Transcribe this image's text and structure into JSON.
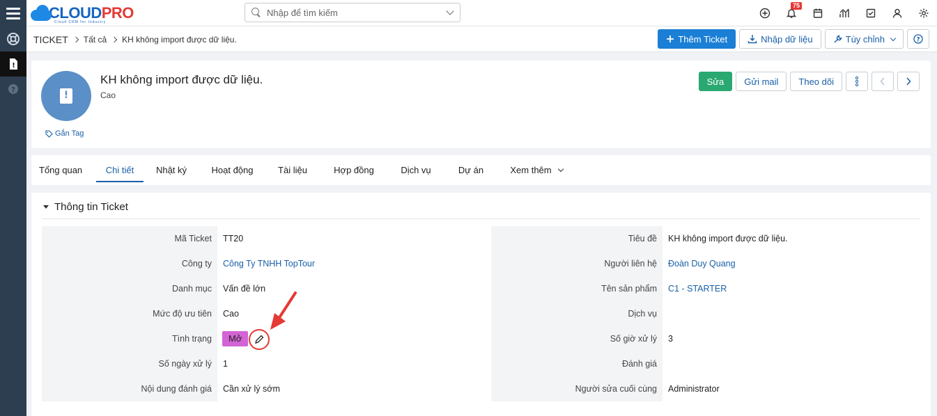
{
  "app": {
    "logo_primary": "CLOUD",
    "logo_secondary": "PRO",
    "logo_tagline": "Cloud CRM for Industry"
  },
  "search": {
    "placeholder": "Nhập để tìm kiếm"
  },
  "notifications": {
    "count": "75"
  },
  "breadcrumb": {
    "module": "TICKET",
    "level1": "Tất cả",
    "current": "KH không import được dữ liệu."
  },
  "toolbar": {
    "add_label": "Thêm Ticket",
    "import_label": "Nhập dữ liệu",
    "customize_label": "Tùy chỉnh"
  },
  "record": {
    "title": "KH không import được dữ liệu.",
    "subtitle": "Cao",
    "tag_label": "Gắn Tag",
    "edit_label": "Sửa",
    "mail_label": "Gửi mail",
    "follow_label": "Theo dõi"
  },
  "tabs": [
    {
      "label": "Tổng quan"
    },
    {
      "label": "Chi tiết"
    },
    {
      "label": "Nhật ký"
    },
    {
      "label": "Hoạt động"
    },
    {
      "label": "Tài liệu"
    },
    {
      "label": "Hợp đồng"
    },
    {
      "label": "Dịch vụ"
    },
    {
      "label": "Dự án"
    },
    {
      "label": "Xem thêm"
    }
  ],
  "section": {
    "title": "Thông tin Ticket",
    "left": [
      {
        "label": "Mã Ticket",
        "value": "TT20"
      },
      {
        "label": "Công ty",
        "value": "Công Ty TNHH TopTour"
      },
      {
        "label": "Danh mục",
        "value": "Vấn đề lớn"
      },
      {
        "label": "Mức độ ưu tiên",
        "value": "Cao"
      },
      {
        "label": "Tình trạng",
        "value": "Mở"
      },
      {
        "label": "Số ngày xử lý",
        "value": "1"
      },
      {
        "label": "Nội dung đánh giá",
        "value": "Cần xử lý sớm"
      }
    ],
    "right": [
      {
        "label": "Tiêu đề",
        "value": "KH không import được dữ liệu."
      },
      {
        "label": "Người liên hệ",
        "value": "Đoàn Duy Quang"
      },
      {
        "label": "Tên sản phẩm",
        "value": "C1 - STARTER"
      },
      {
        "label": "Dịch vụ",
        "value": ""
      },
      {
        "label": "Số giờ xử lý",
        "value": "3"
      },
      {
        "label": "Đánh giá",
        "value": ""
      },
      {
        "label": "Người sửa cuối cùng",
        "value": "Administrator"
      }
    ]
  },
  "colors": {
    "primary": "#1b7fd6",
    "success": "#2aa872",
    "sidebar": "#2c3e50",
    "status_open": "#d264d6",
    "annotation": "#e53935"
  }
}
